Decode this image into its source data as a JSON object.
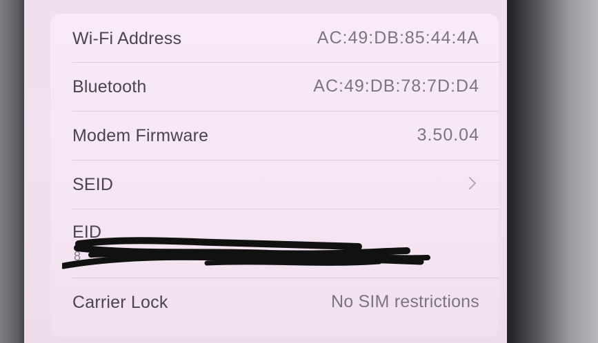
{
  "about_rows": [
    {
      "label": "Wi-Fi Address",
      "value": "AC:49:DB:85:44:4A"
    },
    {
      "label": "Bluetooth",
      "value": "AC:49:DB:78:7D:D4"
    },
    {
      "label": "Modem Firmware",
      "value": "3.50.04"
    },
    {
      "label": "SEID",
      "value": ""
    },
    {
      "label": "EID",
      "value": "8"
    },
    {
      "label": "Carrier Lock",
      "value": "No SIM restrictions"
    }
  ],
  "icons": {
    "seid_chevron": "chevron-right-icon"
  },
  "colors": {
    "screen_background": "#f0dfee",
    "card_background": "#f5e6f3",
    "label_text": "#4a454c",
    "value_text": "#7b7580",
    "separator": "#ddcadb",
    "redaction": "#111111"
  }
}
